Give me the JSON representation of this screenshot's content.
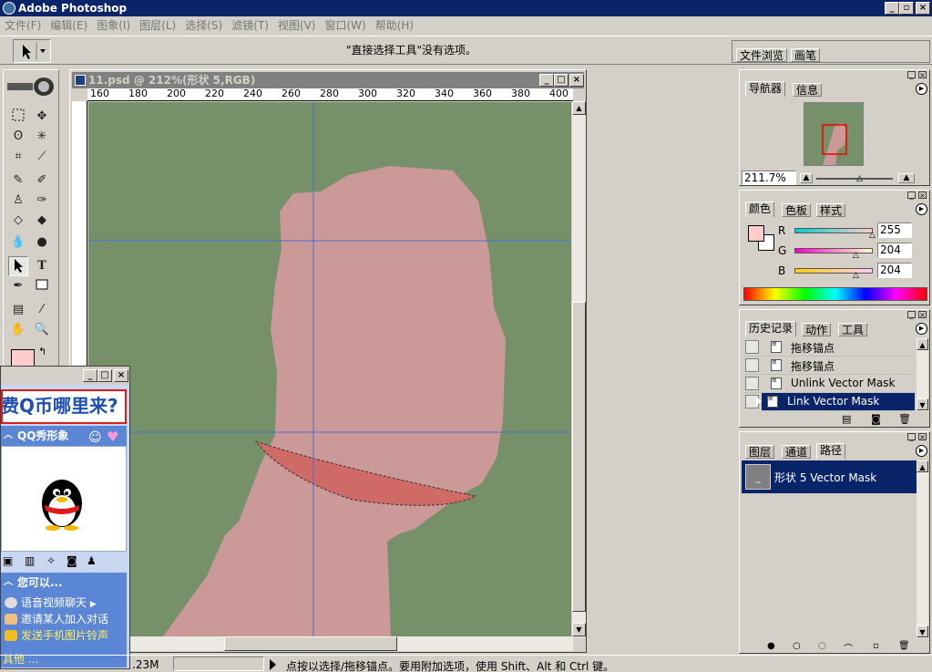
{
  "app": {
    "title": "Adobe Photoshop"
  },
  "menu": [
    "文件(F)",
    "编辑(E)",
    "图象(I)",
    "图层(L)",
    "选择(S)",
    "滤镜(T)",
    "视图(V)",
    "窗口(W)",
    "帮助(H)"
  ],
  "options_bar": {
    "message": "\"直接选择工具\"没有选项。",
    "well_tabs": [
      "文件浏览",
      "画笔"
    ]
  },
  "document": {
    "title": "11.psd @ 212%(形状 5,RGB)",
    "ruler_labels": [
      "160",
      "180",
      "200",
      "220",
      "240",
      "260",
      "280",
      "300",
      "320",
      "340",
      "360",
      "380",
      "400"
    ],
    "canvas_bg": "#76916a",
    "shape_color": "#cc9999",
    "selection_color": "#cf6a66"
  },
  "navigator": {
    "tabs": [
      "导航器",
      "信息"
    ],
    "zoom": "211.7%"
  },
  "color_panel": {
    "tabs": [
      "颜色",
      "色板",
      "样式"
    ],
    "channels": [
      {
        "label": "R",
        "value": "255"
      },
      {
        "label": "G",
        "value": "204"
      },
      {
        "label": "B",
        "value": "204"
      }
    ],
    "foreground": "#ffcccc"
  },
  "history_panel": {
    "tabs": [
      "历史记录",
      "动作",
      "工具"
    ],
    "items": [
      "拖移锚点",
      "拖移锚点",
      "Unlink Vector Mask",
      "Link Vector Mask"
    ]
  },
  "layers_panel": {
    "tabs": [
      "图层",
      "通道",
      "路径"
    ],
    "path_name": "形状 5 Vector Mask"
  },
  "qq": {
    "banner": "费Q币哪里来?",
    "show_title": "QQ秀形象",
    "can_title": "您可以...",
    "actions": [
      "语音视频聊天",
      "邀请某人加入对话",
      "发送手机图片铃声"
    ],
    "other": "其他 ..."
  },
  "status": {
    "doc_size": ".23M",
    "message": "点按以选择/拖移锚点。要用附加选项，使用 Shift、Alt 和 Ctrl 键。"
  }
}
